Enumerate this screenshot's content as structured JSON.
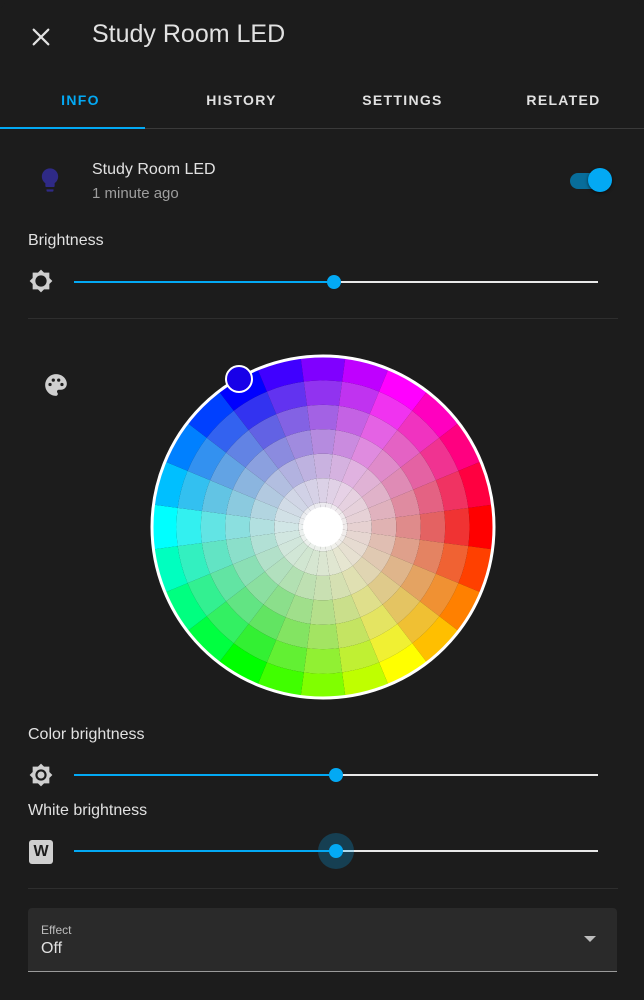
{
  "header": {
    "title": "Study Room LED",
    "close_icon": "close-icon"
  },
  "tabs": [
    {
      "label": "INFO",
      "active": true
    },
    {
      "label": "HISTORY",
      "active": false
    },
    {
      "label": "SETTINGS",
      "active": false
    },
    {
      "label": "RELATED",
      "active": false
    }
  ],
  "entity": {
    "name": "Study Room LED",
    "last_changed": "1 minute ago",
    "icon": "lightbulb-icon",
    "state_on": true
  },
  "brightness": {
    "label": "Brightness",
    "icon": "brightness-icon",
    "value_fraction": 0.497
  },
  "color": {
    "icon": "palette-icon",
    "selected_color": "#1800e8"
  },
  "color_brightness": {
    "label": "Color brightness",
    "icon": "brightness-icon",
    "value_fraction": 0.5
  },
  "white_brightness": {
    "label": "White brightness",
    "icon": "white-w-icon",
    "icon_text": "W",
    "value_fraction": 0.5
  },
  "effect": {
    "label": "Effect",
    "value": "Off"
  },
  "colors": {
    "accent": "#03a9f4",
    "background": "#1c1c1c",
    "text": "#e1e1e1",
    "secondary_text": "#9e9e9e"
  }
}
